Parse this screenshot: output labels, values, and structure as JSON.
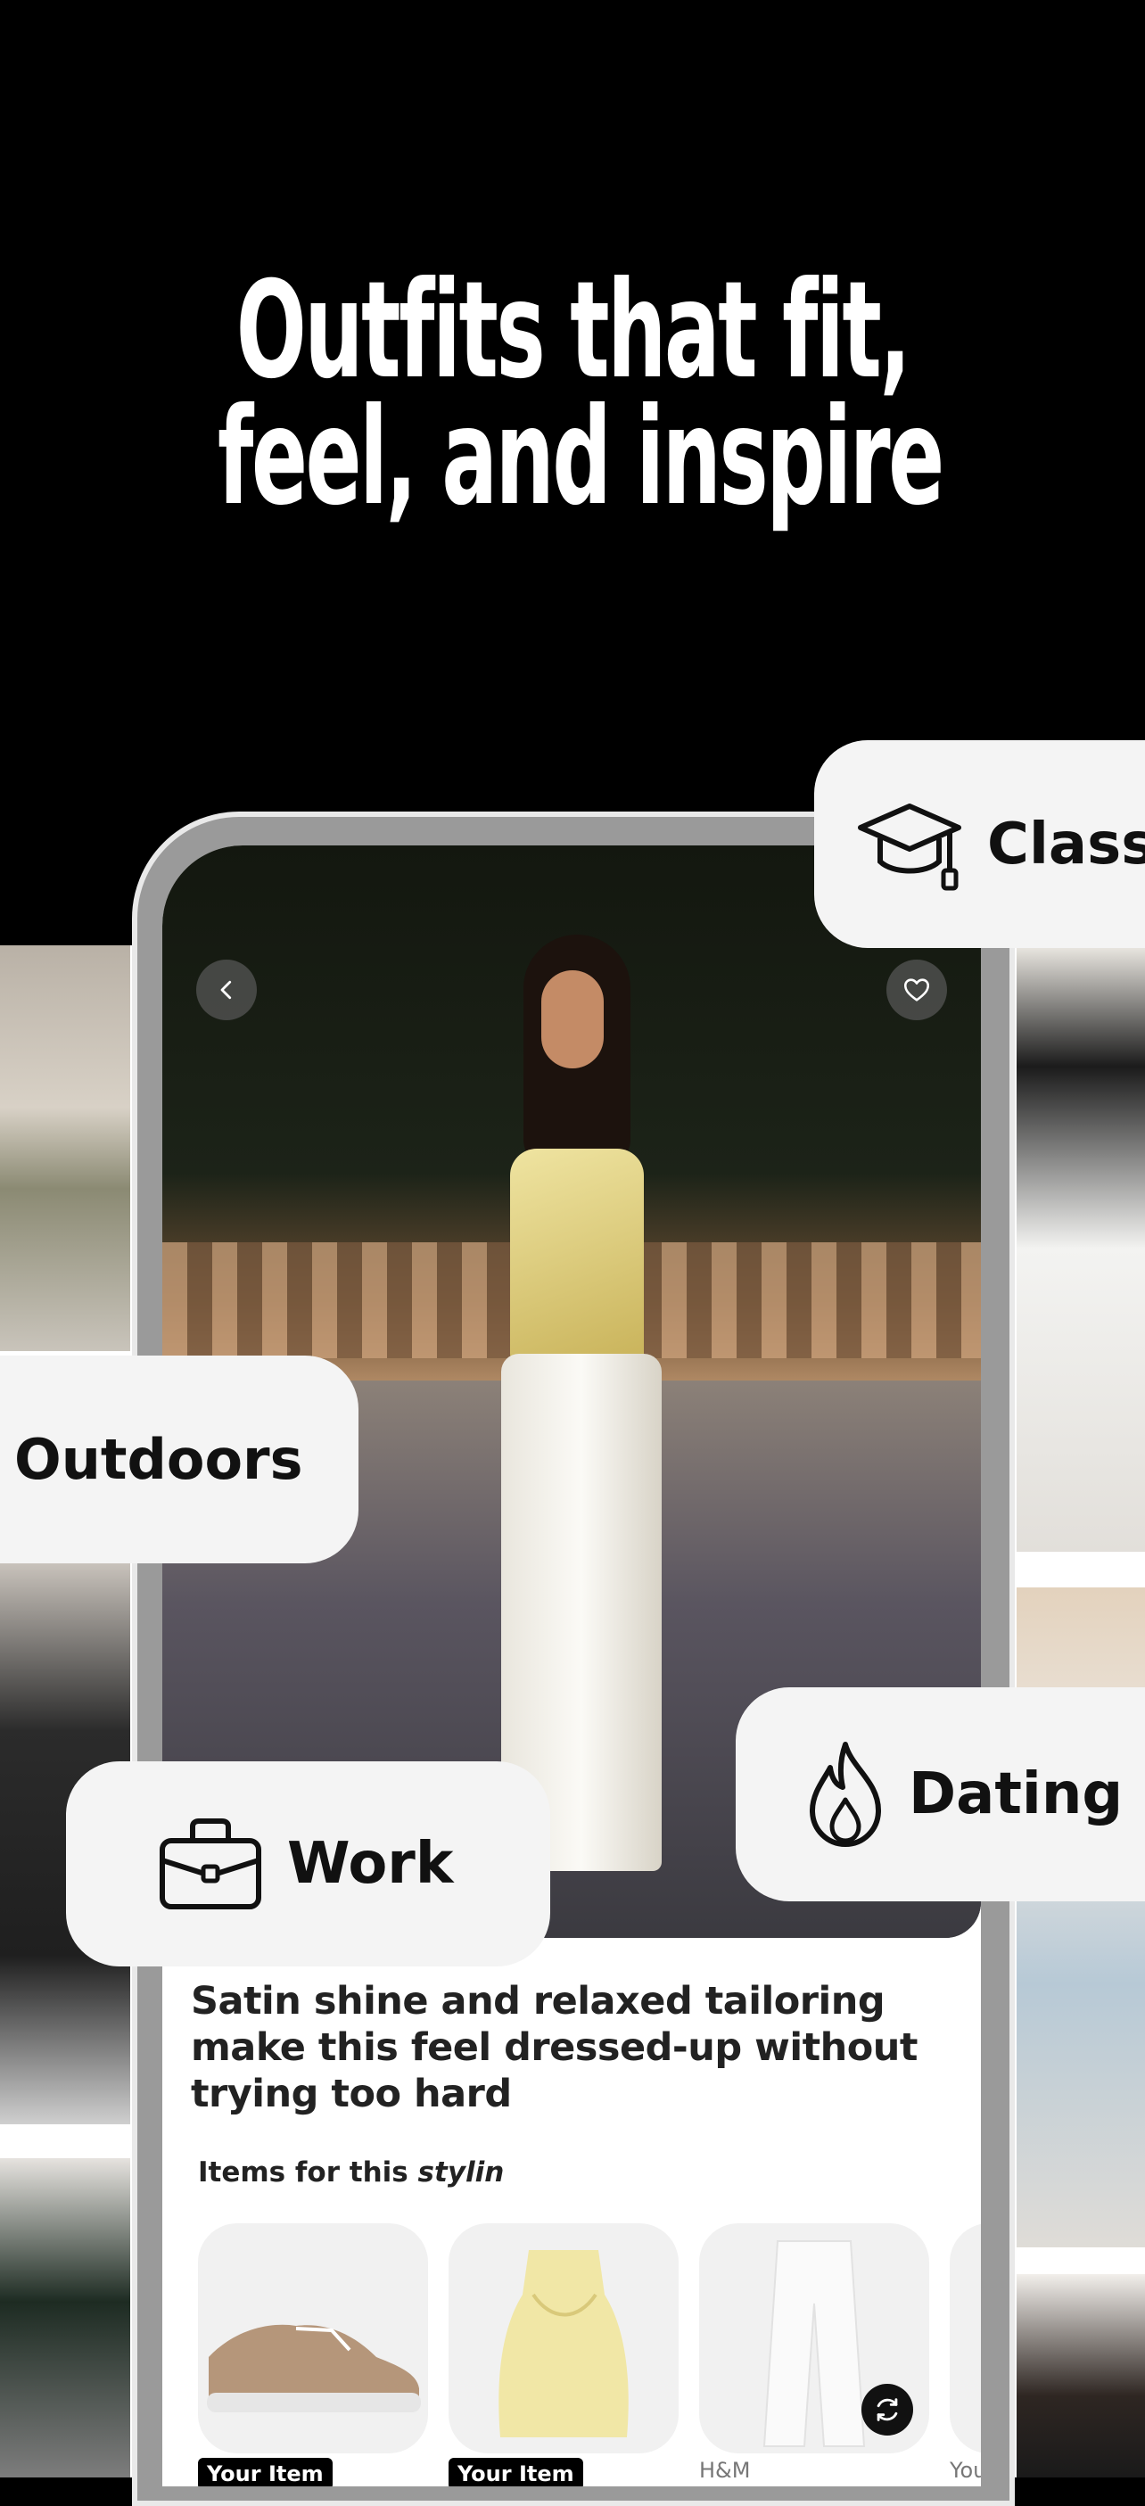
{
  "hero": {
    "line1": "Outfits that fit,",
    "line2": "feel, and inspire"
  },
  "chips": {
    "classes": "Classe",
    "outdoors": "Outdoors",
    "dating": "Dating",
    "work": "Work"
  },
  "card": {
    "caption": "Satin shine and relaxed tailoring make this feel dressed-up without trying too hard",
    "items_title_prefix": "Items for this ",
    "items_title_emphasis": "stylin"
  },
  "items": [
    {
      "label": "Your Item",
      "image": "beige-sneaker"
    },
    {
      "label": "Your Item",
      "image": "yellow-halter-top"
    },
    {
      "label": "H&M",
      "image": "white-trousers"
    },
    {
      "label": "You",
      "image": "partial-item"
    }
  ],
  "icons": {
    "back": "chevron-left-icon",
    "favorite": "heart-icon",
    "classes": "graduation-cap-icon",
    "dating": "flame-icon",
    "work": "briefcase-icon",
    "refresh": "refresh-icon"
  }
}
